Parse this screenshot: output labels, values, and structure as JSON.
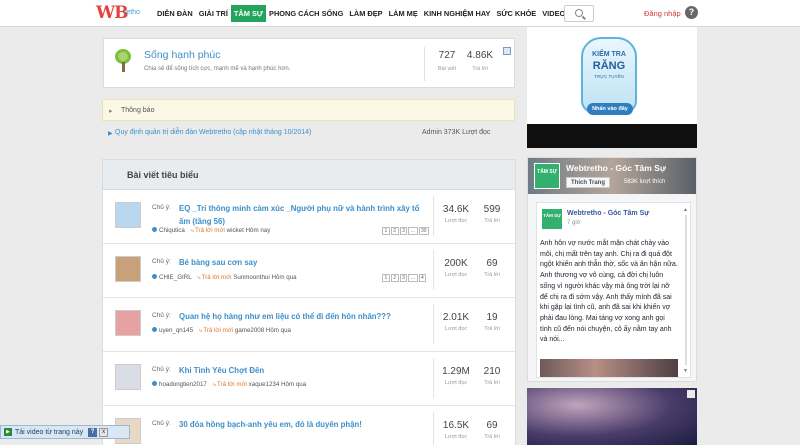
{
  "header": {
    "logo_text": "WB",
    "logo_sub": "retho",
    "nav": [
      "DIỄN ĐÀN",
      "GIẢI TRÍ",
      "TÂM SỰ",
      "PHONG CÁCH SỐNG",
      "LÀM ĐẸP",
      "LÀM MẸ",
      "KINH NGHIỆM HAY",
      "SỨC KHỎE",
      "VIDEO"
    ],
    "active_nav": "TÂM SỰ",
    "login_label": "Đăng nhập",
    "help_label": "?"
  },
  "forum": {
    "title": "Sống hạnh phúc",
    "description": "Chia sẻ để sống tích cực, mạnh mẽ và hạnh phúc hơn.",
    "posts": "727",
    "posts_label": "Bài viết",
    "replies": "4.86K",
    "replies_label": "Trả lời"
  },
  "notice": {
    "heading": "Thông báo",
    "item": "Quy định quản trị diễn đàn Webtretho (cập nhật tháng 10/2014)",
    "meta": "Admin 373K Lượt đọc"
  },
  "featured": {
    "heading": "Bài viết tiêu biểu",
    "threads": [
      {
        "prefix": "Chủ ý:",
        "title": "EQ _Trí thông minh cảm xúc _Người phụ nữ và hành trình xây tổ ấm (tầng 56)",
        "author": "Chiqutica",
        "reply_label": "Trả lời mới",
        "last_user": "wicket",
        "time": "Hôm nay",
        "pages": [
          "1",
          "2",
          "3",
          "...",
          "30"
        ],
        "views": "34.6K",
        "views_label": "Lượt đọc",
        "replies": "599",
        "replies_label": "Trả lời"
      },
      {
        "prefix": "Chủ ý:",
        "title": "Bé bàng sau cơn say",
        "author": "CHIE_GIRL",
        "reply_label": "Trả lời mới",
        "last_user": "Sunmoonthui",
        "time": "Hôm qua",
        "pages": [
          "1",
          "2",
          "3",
          "...",
          "4"
        ],
        "views": "200K",
        "views_label": "Lượt đọc",
        "replies": "69",
        "replies_label": "Trả lời"
      },
      {
        "prefix": "Chủ ý:",
        "title": "Quan hệ họ hàng như em liệu có thể đi đến hôn nhân???",
        "author": "uyen_qn145",
        "reply_label": "Trả lời mới",
        "last_user": "game2008",
        "time": "Hôm qua",
        "pages": [],
        "views": "2.01K",
        "views_label": "Lượt đọc",
        "replies": "19",
        "replies_label": "Trả lời"
      },
      {
        "prefix": "Chủ ý:",
        "title": "Khi Tình Yêu Chợt Đến",
        "author": "hoadongtien2017",
        "reply_label": "Trả lời mới",
        "last_user": "xaque1234",
        "time": "Hôm qua",
        "pages": [],
        "views": "1.29M",
        "views_label": "Lượt đọc",
        "replies": "210",
        "replies_label": "Trả lời"
      },
      {
        "prefix": "Chủ ý:",
        "title": "30 đóa hồng bạch-anh yêu em, đó là duyên phận!",
        "author": "",
        "reply_label": "",
        "last_user": "",
        "time": "",
        "pages": [],
        "views": "16.5K",
        "views_label": "Lượt đọc",
        "replies": "69",
        "replies_label": "Trả lời"
      }
    ]
  },
  "sidebar": {
    "ad_top": {
      "line1": "KIỂM TRA",
      "line2": "RĂNG",
      "line3": "TRỰC TUYẾN",
      "button": "Nhấn vào đây"
    },
    "facebook": {
      "page_name": "Webtretho - Góc Tâm Sự",
      "logo_text": "TÂM SỰ",
      "like_label": "Thích Trang",
      "likes": "583K lượt thích",
      "post_author": "Webtretho - Góc Tâm Sự",
      "post_time": "7 giờ",
      "post_body": "Anh hôn vợ nước mắt mặn chát chảy vào môi, chị mất trên tay anh. Chị ra đi quá đột ngột khiến anh thẫn thờ, sốc và ân hận nữa. Anh thương vợ vô cùng, cả đời chị luôn sống vì người khác vậy mà ông trời lại nỡ để chị ra đi sớm vậy. Anh thấy mình đã sai khi gặp lại tình cũ, anh đã sai khi khiến vợ phải đau lòng. Mai táng vợ xong anh gọi tình cũ đến nói chuyện, cô ấy nằm tay anh và nói..."
    }
  },
  "download_bar": {
    "label": "Tải video từ trang này",
    "help": "?",
    "close": "x"
  },
  "colors": {
    "brand_green": "#22a45d",
    "link_blue": "#3d8fc9",
    "reply_orange": "#e0762a"
  }
}
